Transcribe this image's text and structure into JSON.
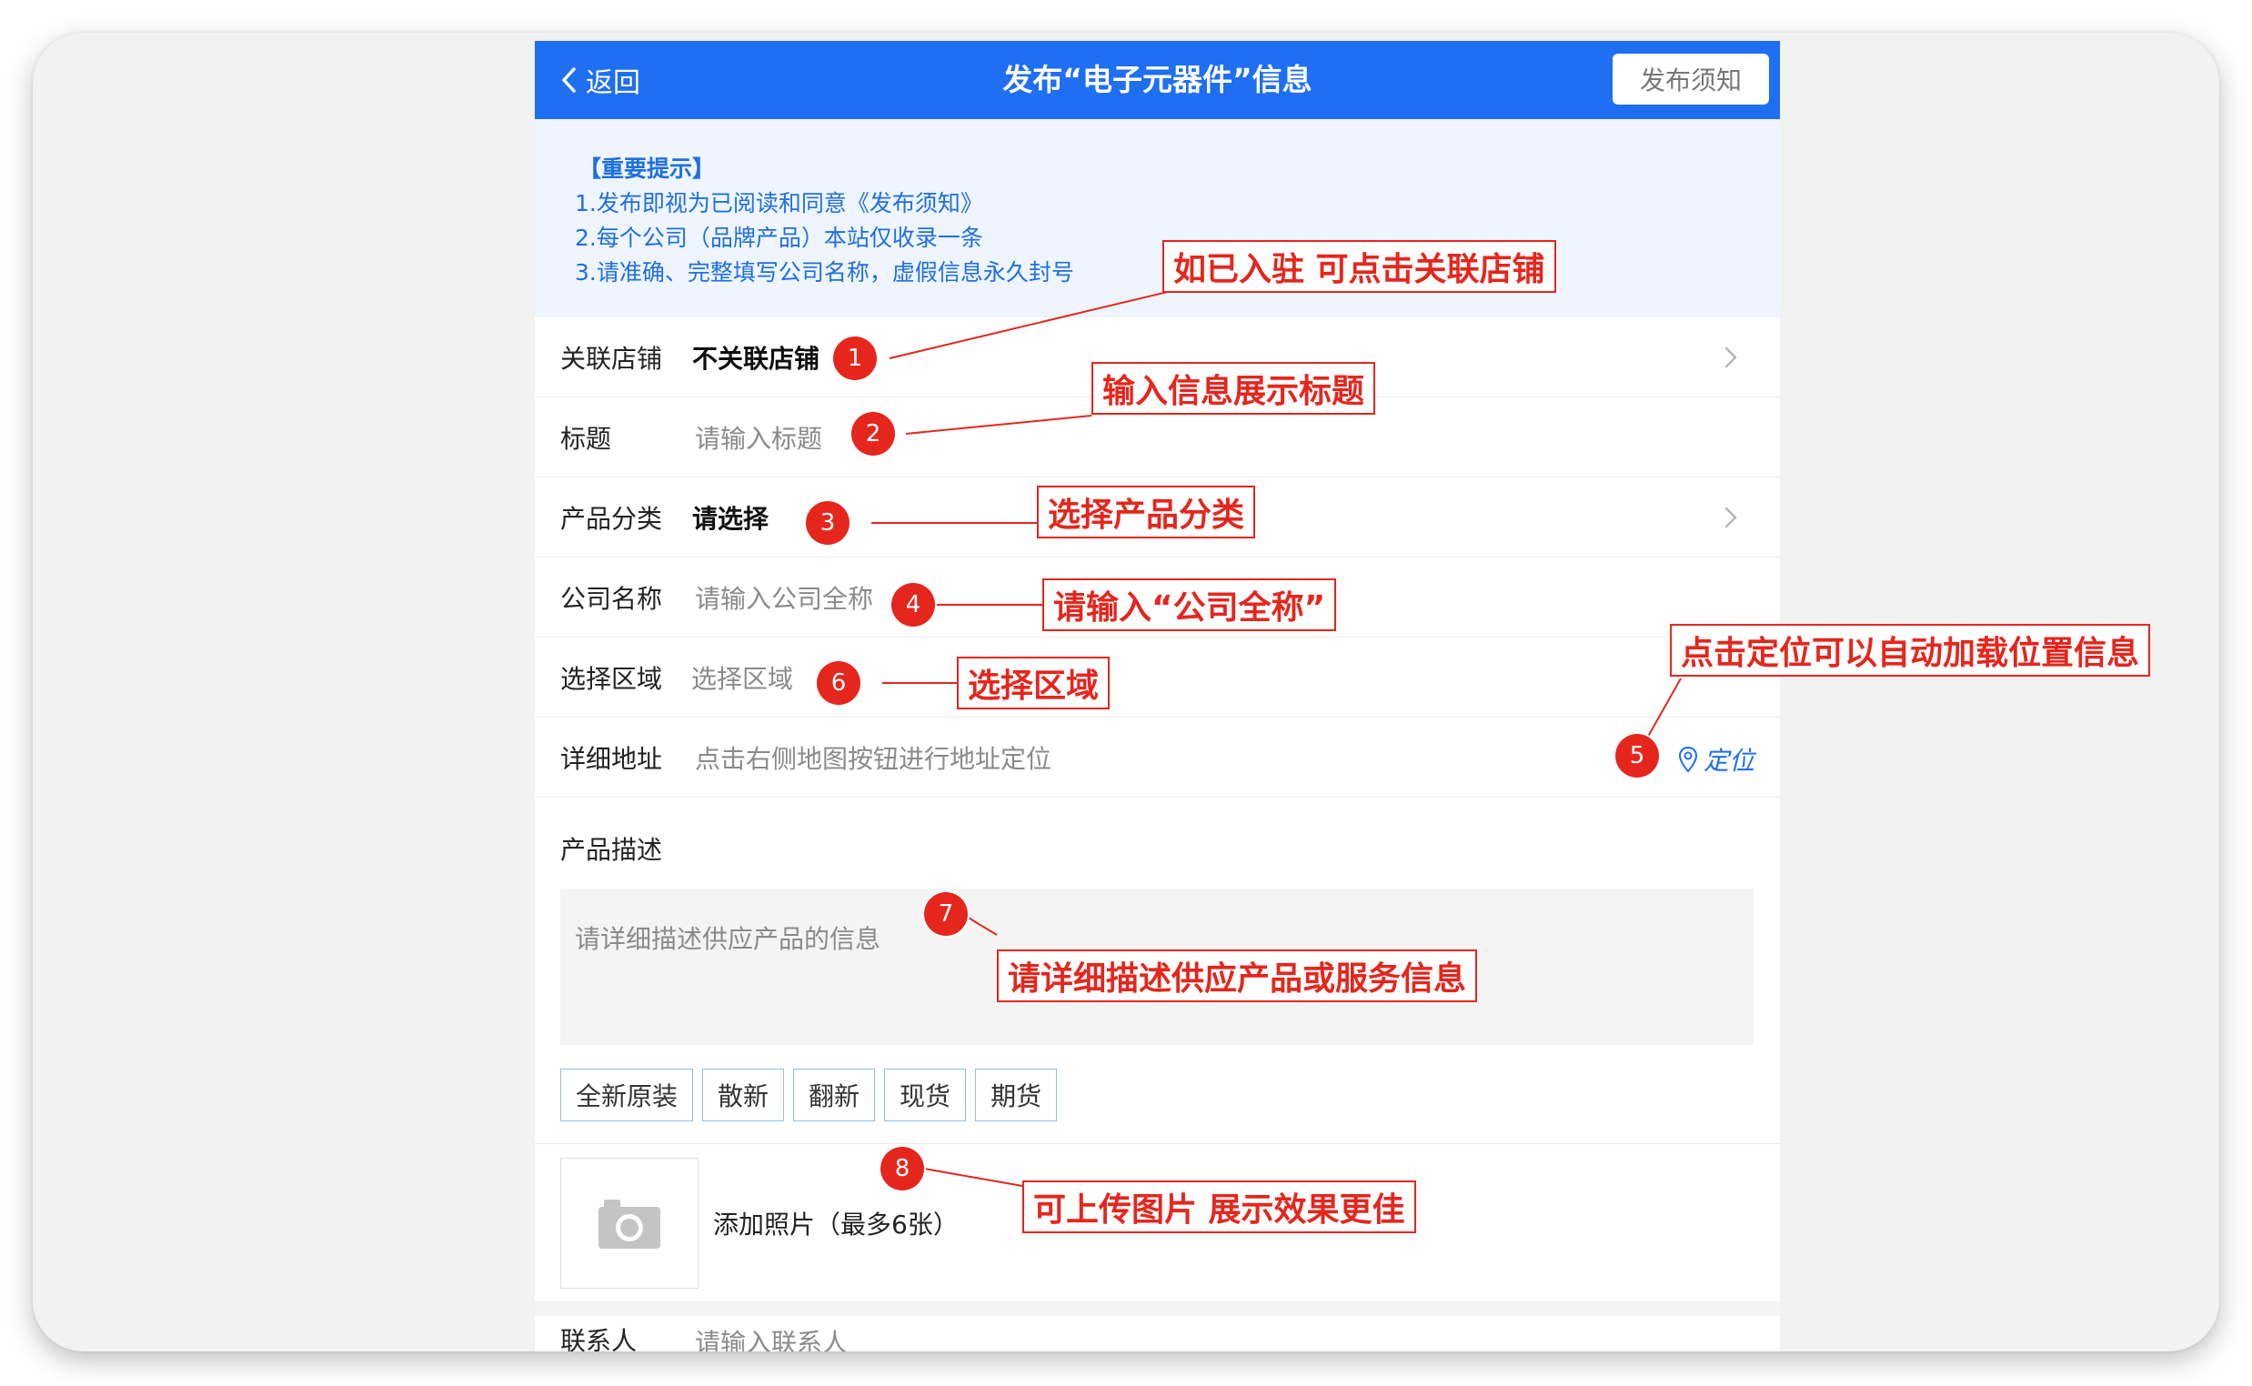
{
  "nav": {
    "back_label": "返回",
    "title": "发布“电子元器件”信息",
    "notice_button": "发布须知"
  },
  "notice": {
    "title": "【重要提示】",
    "lines": [
      "1.发布即视为已阅读和同意《发布须知》",
      "2.每个公司（品牌产品）本站仅收录一条",
      "3.请准确、完整填写公司名称，虚假信息永久封号"
    ]
  },
  "form": {
    "shop": {
      "label": "关联店铺",
      "value": "不关联店铺"
    },
    "title": {
      "label": "标题",
      "placeholder": "请输入标题"
    },
    "category": {
      "label": "产品分类",
      "value": "请选择"
    },
    "company": {
      "label": "公司名称",
      "placeholder": "请输入公司全称"
    },
    "region": {
      "label": "选择区域",
      "placeholder": "选择区域"
    },
    "address": {
      "label": "详细地址",
      "placeholder": "点击右侧地图按钮进行地址定位",
      "locate_label": "定位"
    },
    "description": {
      "label": "产品描述",
      "placeholder": "请详细描述供应产品的信息"
    },
    "tags": [
      "全新原装",
      "散新",
      "翻新",
      "现货",
      "期货"
    ],
    "photo": {
      "label": "添加照片（最多6张）"
    },
    "contact": {
      "label": "联系人",
      "placeholder": "请输入联系人"
    }
  },
  "annotations": {
    "badges": [
      "1",
      "2",
      "3",
      "4",
      "5",
      "6",
      "7",
      "8"
    ],
    "callouts": {
      "c1": "如已入驻 可点击关联店铺",
      "c2": "输入信息展示标题",
      "c3": "选择产品分类",
      "c4": "请输入“公司全称”",
      "c5": "点击定位可以自动加载位置信息",
      "c6": "选择区域",
      "c7": "请详细描述供应产品或服务信息",
      "c8": "可上传图片 展示效果更佳"
    }
  },
  "colors": {
    "nav_blue": "#1e6ff1",
    "notice_text": "#1f6fdf",
    "annotation_red": "#e5261d"
  }
}
